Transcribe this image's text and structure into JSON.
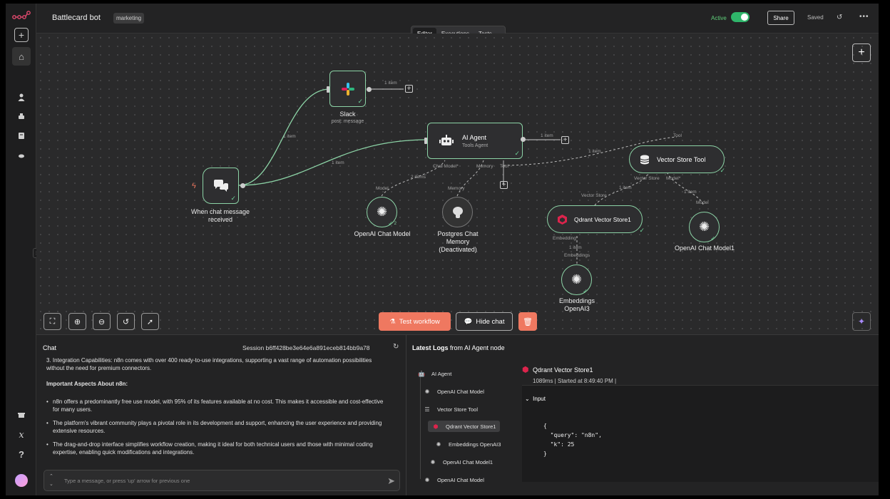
{
  "app": {
    "workflow_name": "Battlecard bot",
    "tag": "marketing",
    "active_label": "Active",
    "share_label": "Share",
    "saved_label": "Saved"
  },
  "tabs": [
    "Editor",
    "Executions",
    "Tests"
  ],
  "nodes": {
    "trigger": {
      "label": "When chat message received"
    },
    "slack": {
      "label": "Slack",
      "sub": "post: message"
    },
    "agent": {
      "label": "AI Agent",
      "sub": "Tools Agent",
      "ports": [
        "Chat Model*",
        "Memory",
        "Tool"
      ]
    },
    "openai_model": {
      "label": "OpenAI Chat Model",
      "port": "Model",
      "badge": "2"
    },
    "postgres": {
      "label": "Postgres Chat Memory (Deactivated)",
      "port": "Memory"
    },
    "vector_tool": {
      "label": "Vector Store Tool",
      "ports": [
        "Vector Store",
        "Model*"
      ],
      "top_port": "Tool"
    },
    "qdrant": {
      "label": "Qdrant Vector Store1",
      "port": "Vector Store",
      "bottom_port": "Embedding*"
    },
    "openai_model1": {
      "label": "OpenAI Chat Model1",
      "port": "Model"
    },
    "embeddings": {
      "label": "Embeddings OpenAI3",
      "port": "Embeddings"
    }
  },
  "edges": {
    "e1": "1 item",
    "e2": "1 item",
    "e3": "1 item",
    "e4": "1 item",
    "e5": "2 items",
    "e6": "1 item",
    "e7": "1 item",
    "e8": "1 item",
    "e9": "1 item"
  },
  "canvas_buttons": {
    "test": "Test workflow",
    "hide_chat": "Hide chat"
  },
  "chat": {
    "title": "Chat",
    "session": "Session  b6ff428be3e64e6a891eceb814bb9a78",
    "p1": "3. Integration Capabilities: n8n comes with over 400 ready-to-use integrations, supporting a vast range of automation possibilities without the need for premium connectors.",
    "heading": "Important Aspects About n8n:",
    "bullets": [
      "n8n offers a predominantly free use model, with 95% of its features available at no cost. This makes it accessible and cost-effective for many users.",
      "The platform's vibrant community plays a pivotal role in its development and support, enhancing the user experience and providing extensive resources.",
      "The drag-and-drop interface simplifies workflow creation, making it ideal for both technical users and those with minimal coding expertise, enabling quick modifications and integrations."
    ],
    "placeholder": "Type a message, or press 'up' arrow for previous one"
  },
  "logs": {
    "title_bold": "Latest Logs",
    "title_rest": "from AI Agent node",
    "tree": [
      "AI Agent",
      "OpenAI Chat Model",
      "Vector Store Tool",
      "Qdrant Vector Store1",
      "Embeddings OpenAI3",
      "OpenAI Chat Model1",
      "OpenAI Chat Model"
    ],
    "selected_title": "Qdrant Vector Store1",
    "selected_meta": "1089ms | Started at 8:49:40 PM |",
    "input_label": "Input",
    "code": "{\n  \"query\": \"n8n\",\n  \"k\": 25\n}"
  },
  "colors": {
    "accent": "#ef7860",
    "success": "#8cd3a6",
    "active": "#2fb56a"
  }
}
